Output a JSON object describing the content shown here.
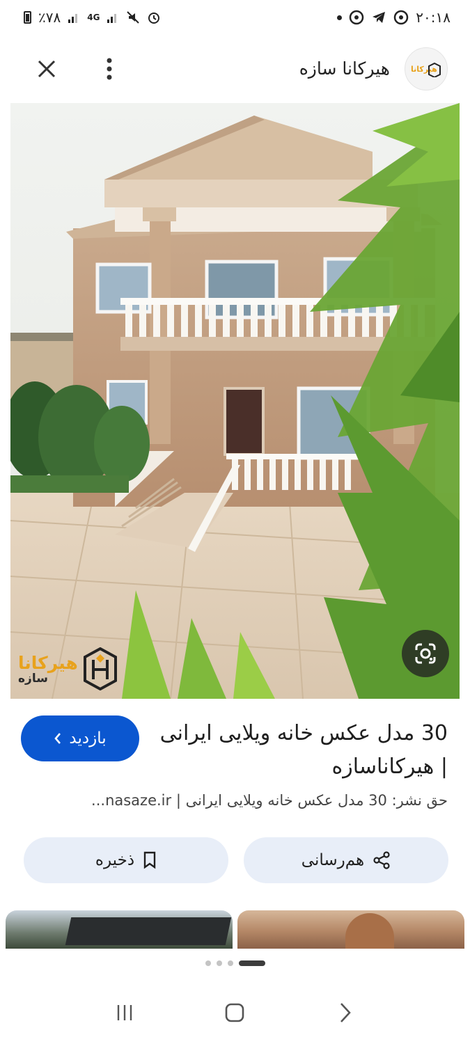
{
  "status_bar": {
    "time": "۲۰:۱۸",
    "battery": "٪۷۸",
    "network": "4G"
  },
  "header": {
    "site_name": "هیرکانا سازه",
    "logo_text": "هیرکانا"
  },
  "image": {
    "watermark_brand": "هیرکانا",
    "watermark_sub": "سازه"
  },
  "result": {
    "title": "30 مدل عکس خانه ویلایی ایرانی | هیرکاناسازه",
    "copyright": "حق نشر: 30 مدل عکس خانه ویلایی ایرانی | nasaze.ir...",
    "visit_label": "بازدید"
  },
  "actions": {
    "share_label": "هم‌رسانی",
    "save_label": "ذخیره"
  },
  "pager": {
    "count": 4,
    "active_index": 3
  },
  "icons": {
    "close": "close-icon",
    "more": "more-vert-icon",
    "lens": "lens-icon",
    "share": "share-icon",
    "save": "bookmark-icon",
    "visit": "chevron-icon",
    "nav_recent": "recent-apps-icon",
    "nav_home": "home-icon",
    "nav_back": "back-icon"
  },
  "colors": {
    "accent": "#0b57d0",
    "chip_bg": "#e8eef8",
    "watermark": "#e8a21c"
  }
}
